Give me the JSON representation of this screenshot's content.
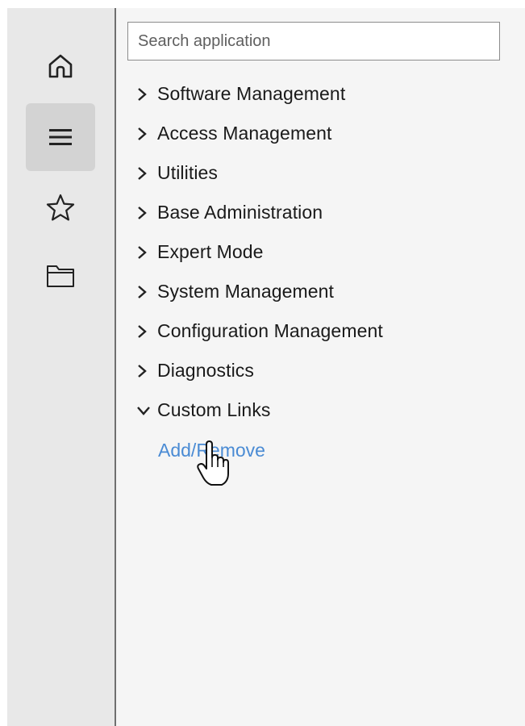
{
  "rail": {
    "items": [
      {
        "icon": "home-icon",
        "active": false
      },
      {
        "icon": "menu-icon",
        "active": true
      },
      {
        "icon": "star-icon",
        "active": false
      },
      {
        "icon": "folder-icon",
        "active": false
      }
    ]
  },
  "search": {
    "placeholder": "Search application",
    "value": ""
  },
  "tree": {
    "items": [
      {
        "label": "Software Management",
        "expanded": false
      },
      {
        "label": "Access Management",
        "expanded": false
      },
      {
        "label": "Utilities",
        "expanded": false
      },
      {
        "label": "Base Administration",
        "expanded": false
      },
      {
        "label": "Expert Mode",
        "expanded": false
      },
      {
        "label": "System Management",
        "expanded": false
      },
      {
        "label": "Configuration Management",
        "expanded": false
      },
      {
        "label": "Diagnostics",
        "expanded": false
      },
      {
        "label": "Custom Links",
        "expanded": true
      }
    ],
    "custom_links": {
      "link_label": "Add/Remove"
    }
  },
  "colors": {
    "rail_bg": "#e8e8e8",
    "rail_active_bg": "#d3d3d3",
    "panel_bg": "#f5f5f5",
    "link": "#4a8bd4"
  },
  "cursor": "hand-pointer-icon"
}
